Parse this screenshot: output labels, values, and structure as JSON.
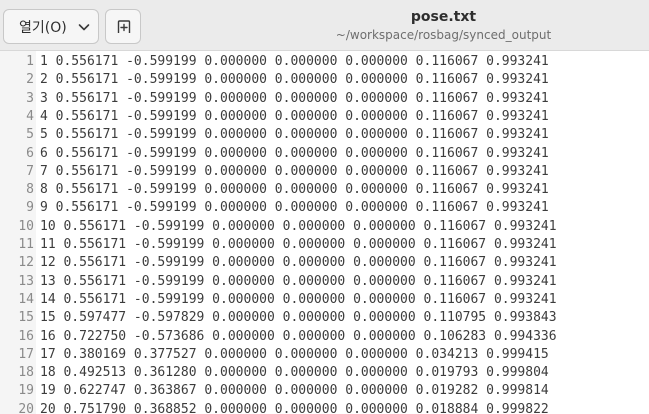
{
  "header": {
    "open_label": "열기(O)",
    "title": "pose.txt",
    "path": "~/workspace/rosbag/synced_output"
  },
  "icons": {
    "open_dropdown": "chevron-down-icon",
    "new_tab": "new-tab-icon"
  },
  "editor": {
    "lines": [
      {
        "num": "1",
        "text": "1 0.556171 -0.599199 0.000000 0.000000 0.000000 0.116067 0.993241"
      },
      {
        "num": "2",
        "text": "2 0.556171 -0.599199 0.000000 0.000000 0.000000 0.116067 0.993241"
      },
      {
        "num": "3",
        "text": "3 0.556171 -0.599199 0.000000 0.000000 0.000000 0.116067 0.993241"
      },
      {
        "num": "4",
        "text": "4 0.556171 -0.599199 0.000000 0.000000 0.000000 0.116067 0.993241"
      },
      {
        "num": "5",
        "text": "5 0.556171 -0.599199 0.000000 0.000000 0.000000 0.116067 0.993241"
      },
      {
        "num": "6",
        "text": "6 0.556171 -0.599199 0.000000 0.000000 0.000000 0.116067 0.993241"
      },
      {
        "num": "7",
        "text": "7 0.556171 -0.599199 0.000000 0.000000 0.000000 0.116067 0.993241"
      },
      {
        "num": "8",
        "text": "8 0.556171 -0.599199 0.000000 0.000000 0.000000 0.116067 0.993241"
      },
      {
        "num": "9",
        "text": "9 0.556171 -0.599199 0.000000 0.000000 0.000000 0.116067 0.993241"
      },
      {
        "num": "10",
        "text": "10 0.556171 -0.599199 0.000000 0.000000 0.000000 0.116067 0.993241"
      },
      {
        "num": "11",
        "text": "11 0.556171 -0.599199 0.000000 0.000000 0.000000 0.116067 0.993241"
      },
      {
        "num": "12",
        "text": "12 0.556171 -0.599199 0.000000 0.000000 0.000000 0.116067 0.993241"
      },
      {
        "num": "13",
        "text": "13 0.556171 -0.599199 0.000000 0.000000 0.000000 0.116067 0.993241"
      },
      {
        "num": "14",
        "text": "14 0.556171 -0.599199 0.000000 0.000000 0.000000 0.116067 0.993241"
      },
      {
        "num": "15",
        "text": "15 0.597477 -0.597829 0.000000 0.000000 0.000000 0.110795 0.993843"
      },
      {
        "num": "16",
        "text": "16 0.722750 -0.573686 0.000000 0.000000 0.000000 0.106283 0.994336"
      },
      {
        "num": "17",
        "text": "17 0.380169 0.377527 0.000000 0.000000 0.000000 0.034213 0.999415"
      },
      {
        "num": "18",
        "text": "18 0.492513 0.361280 0.000000 0.000000 0.000000 0.019793 0.999804"
      },
      {
        "num": "19",
        "text": "19 0.622747 0.363867 0.000000 0.000000 0.000000 0.019282 0.999814"
      },
      {
        "num": "20",
        "text": "20 0.751790 0.368852 0.000000 0.000000 0.000000 0.018884 0.999822"
      }
    ]
  }
}
